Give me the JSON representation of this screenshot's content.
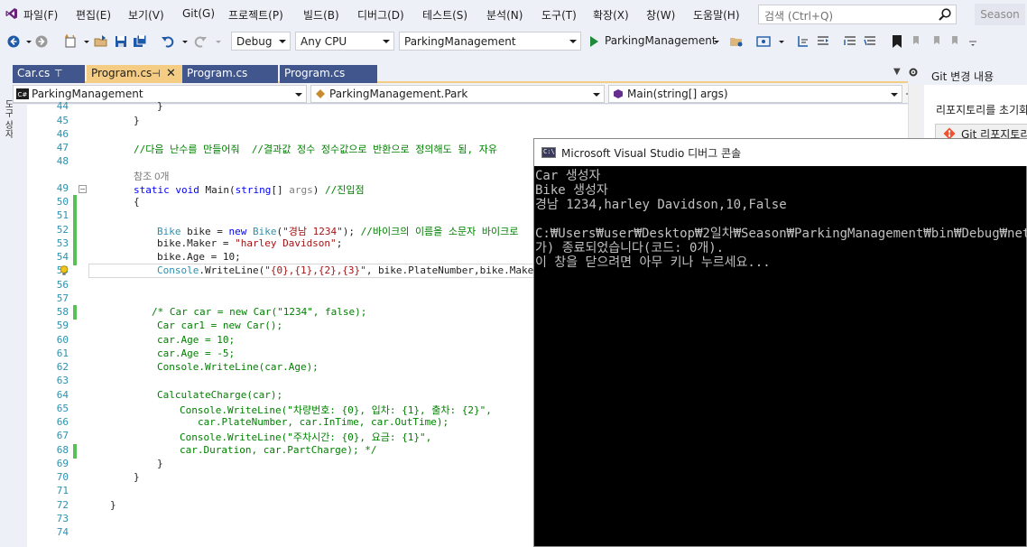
{
  "menu": {
    "items": [
      "파일(F)",
      "편집(E)",
      "보기(V)",
      "Git(G)",
      "프로젝트(P)",
      "빌드(B)",
      "디버그(D)",
      "테스트(S)",
      "분석(N)",
      "도구(T)",
      "확장(X)",
      "창(W)",
      "도움말(H)"
    ],
    "search_placeholder": "검색 (Ctrl+Q)",
    "solution_name": "Season"
  },
  "toolbar": {
    "configuration": "Debug",
    "platform": "Any CPU",
    "startup_project": "ParkingManagement",
    "start_label": "ParkingManagement"
  },
  "tabs": [
    {
      "label": "Car.cs",
      "active": false,
      "pinned": true
    },
    {
      "label": "Program.cs",
      "active": true,
      "pinned": true,
      "closable": true
    },
    {
      "label": "Program.cs",
      "active": false
    },
    {
      "label": "Program.cs",
      "active": false
    }
  ],
  "navbar": {
    "project": "ParkingManagement",
    "type": "ParkingManagement.Park",
    "member": "Main(string[] args)"
  },
  "left_strip": "도구 상자",
  "editor": {
    "line_numbers": [
      "44",
      "45",
      "46",
      "47",
      "48",
      "49",
      "50",
      "51",
      "52",
      "53",
      "54",
      "55",
      "56",
      "57",
      "58",
      "59",
      "60",
      "61",
      "62",
      "63",
      "64",
      "65",
      "66",
      "67",
      "68",
      "69",
      "70",
      "71",
      "72",
      "73",
      "74"
    ],
    "references_label": "참조 0개",
    "lines": {
      "l44": "}",
      "l45": "}",
      "l47": "//다음 난수를 만들어줘  //결과값 정수 정수값으로 반환으로 정의해도 됨, 자유",
      "l49_kw1": "static",
      "l49_kw2": "void",
      "l49_name": " Main(",
      "l49_kw3": "string",
      "l49_rest": "[] ",
      "l49_param": "args",
      "l49_end": ") ",
      "l49_cmt": "//진입점",
      "l50": "{",
      "l52_type": "Bike",
      "l52_a": " bike = ",
      "l52_new": "new",
      "l52_type2": " Bike",
      "l52_b": "(",
      "l52_str": "\"경남 1234\"",
      "l52_c": "); ",
      "l52_cmt": "//바이크의 이름을 소문자 바이크로",
      "l53_a": "bike.Maker = ",
      "l53_str": "\"harley Davidson\"",
      "l53_b": ";",
      "l54": "bike.Age = 10;",
      "l55_type": "Console",
      "l55_a": ".WriteLine(",
      "l55_str": "\"{0},{1},{2},{3}\"",
      "l55_b": ", bike.PlateNumber,bike.Maker,",
      "l58": "/* Car car = new Car(\"1234\", false);",
      "l59": "Car car1 = new Car();",
      "l60": "car.Age = 10;",
      "l61": "car.Age = -5;",
      "l62": "Console.WriteLine(car.Age);",
      "l64": "CalculateCharge(car);",
      "l65": "Console.WriteLine(\"차량번호: {0}, 입차: {1}, 출차: {2}\",",
      "l66": "car.PlateNumber, car.InTime, car.OutTime);",
      "l67": "Console.WriteLine(\"주차시간: {0}, 요금: {1}\",",
      "l68": "car.Duration, car.PartCharge); */",
      "l69": "}",
      "l70": "}",
      "l72": "}"
    }
  },
  "right_panel": {
    "title": "Git 변경 내용",
    "text": "리포지토리를 초기화",
    "button": "Git 리포지토리"
  },
  "console": {
    "title": "Microsoft Visual Studio 디버그 콘솔",
    "lines": [
      "Car 생성자",
      "Bike 생성자",
      "경남 1234,harley Davidson,10,False",
      "",
      "C:₩Users₩user₩Desktop₩2일차₩Season₩ParkingManagement₩bin₩Debug₩netcoreapp",
      "가) 종료되었습니다(코드: 0개).",
      "이 창을 닫으려면 아무 키나 누르세요..."
    ]
  },
  "colors": {
    "keyword": "#0000ff",
    "type": "#2b91af",
    "string": "#a31515",
    "comment": "#008000",
    "active_tab": "#f5cc84",
    "inactive_tab": "#40568d",
    "change_bar": "#57c158"
  }
}
